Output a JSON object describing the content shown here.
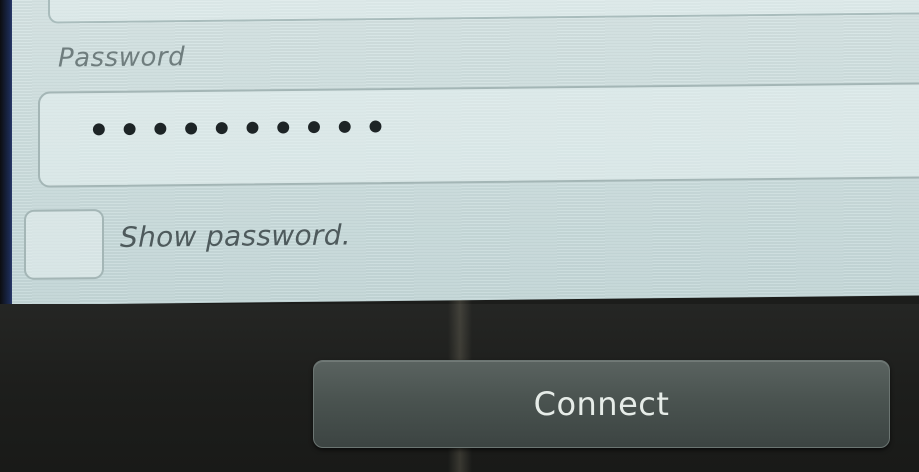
{
  "form": {
    "password_label": "Password",
    "password_value": "••••••••••",
    "show_password_label": "Show password.",
    "show_password_checked": false
  },
  "actions": {
    "connect_label": "Connect"
  },
  "colors": {
    "panel_background": "#cfe0e0",
    "button_bar_background": "#1d1e1c",
    "button_background": "#4a5350",
    "button_text": "#e6ece8"
  }
}
